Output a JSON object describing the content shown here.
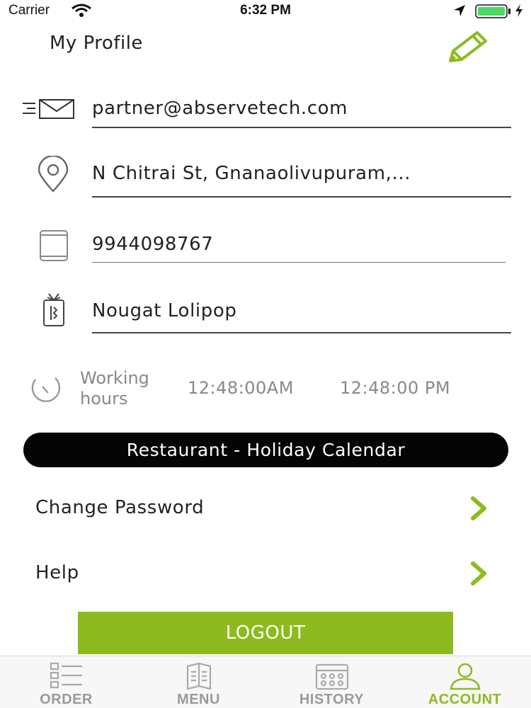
{
  "status_bar": {
    "carrier": "Carrier",
    "time": "6:32 PM"
  },
  "header": {
    "title": "My Profile"
  },
  "profile": {
    "email": "partner@abservetech.com",
    "address": "N Chitrai St, Gnanaolivupuram,...",
    "phone": "9944098767",
    "version": "Nougat Lolipop"
  },
  "working_hours": {
    "label": "Working hours",
    "start": "12:48:00AM",
    "end": "12:48:00 PM"
  },
  "holiday_button": "Restaurant - Holiday Calendar",
  "menu": {
    "change_password": "Change Password",
    "help": "Help"
  },
  "logout_label": "LOGOUT",
  "tabs": [
    {
      "label": "ORDER",
      "icon": "list-icon",
      "active": false
    },
    {
      "label": "MENU",
      "icon": "menu-card-icon",
      "active": false
    },
    {
      "label": "HISTORY",
      "icon": "calendar-icon",
      "active": false
    },
    {
      "label": "ACCOUNT",
      "icon": "user-icon",
      "active": true
    }
  ],
  "colors": {
    "accent": "#8dbb1f",
    "pill": "#050505",
    "text": "#222222",
    "muted": "#888888"
  }
}
